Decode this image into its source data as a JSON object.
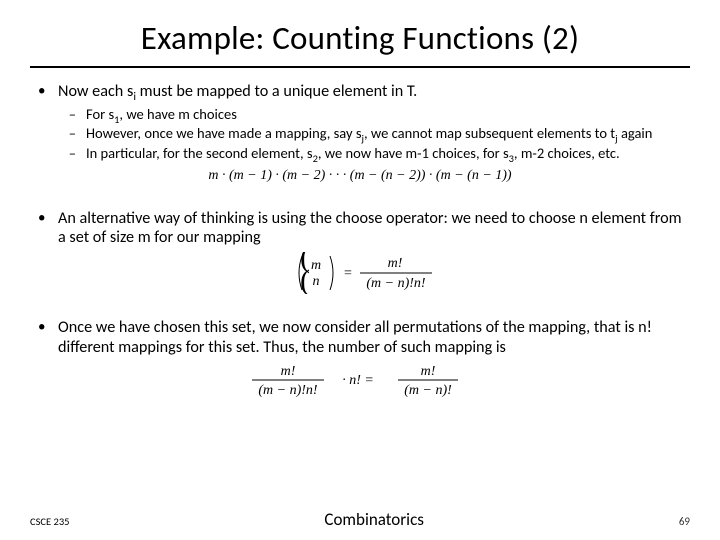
{
  "title": "Example: Counting Functions (2)",
  "bullets": {
    "b1a_pre": "Now each s",
    "b1a_sub": "i",
    "b1a_post": " must be mapped to a unique element in T.",
    "b2a_pre": "For s",
    "b2a_sub": "1",
    "b2a_post": ", we have m choices",
    "b2b_pre": "However, once we have made a mapping, say s",
    "b2b_sub": "j",
    "b2b_mid": ", we cannot map subsequent elements to t",
    "b2b_sub2": "j",
    "b2b_post": " again",
    "b2c_pre": "In particular, for the second element, s",
    "b2c_sub": "2",
    "b2c_mid": ", we now have m-1 choices, for s",
    "b2c_sub2": "3",
    "b2c_post": ", m-2 choices, etc.",
    "b1b": "An alternative way of thinking is using the choose operator: we need to choose n element from a set of size m for our mapping",
    "b1c": "Once we have chosen this set, we now consider all permutations of the mapping, that is n! different mappings for this set.  Thus, the number of such mapping is"
  },
  "formulas": {
    "f1": "m · (m − 1) · (m − 2) · · · (m − (n − 2)) · (m − (n − 1))",
    "f2_left_top": "m",
    "f2_left_bot": "n",
    "f2_right_num": "m!",
    "f2_right_den": "(m − n)!n!",
    "f3_a_num": "m!",
    "f3_a_den": "(m − n)!n!",
    "f3_mid": " · n! = ",
    "f3_b_num": "m!",
    "f3_b_den": "(m − n)!"
  },
  "footer": {
    "course": "CSCE 235",
    "center": "Combinatorics",
    "page": "69"
  }
}
